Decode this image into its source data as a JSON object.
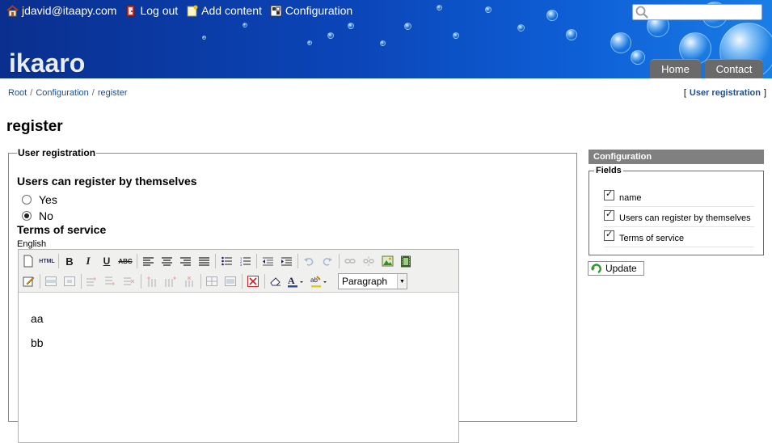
{
  "header": {
    "user": "jdavid@itaapy.com",
    "logout": "Log out",
    "add_content": "Add content",
    "configuration": "Configuration",
    "logo": "ikaaro",
    "search_placeholder": "",
    "nav": [
      "Home",
      "Contact"
    ]
  },
  "breadcrumb": {
    "items": [
      "Root",
      "Configuration",
      "register"
    ],
    "sep": "/",
    "toggle_open": "[",
    "toggle_label": "User registration",
    "toggle_close": "]"
  },
  "page": {
    "title": "register"
  },
  "form": {
    "legend": "User registration",
    "question": "Users can register by themselves",
    "options": [
      "Yes",
      "No"
    ],
    "selected": "No",
    "terms_label": "Terms of service",
    "language": "English",
    "format_select": "Paragraph",
    "content_lines": [
      "aa",
      "bb"
    ]
  },
  "sidebar": {
    "title": "Configuration",
    "fields_legend": "Fields",
    "fields": [
      "name",
      "Users can register by themselves",
      "Terms of service"
    ],
    "update_label": "Update"
  },
  "colors": {
    "header_blue": "#0b45b8",
    "link_blue": "#1c4f94",
    "tab_gray": "#6a6a6a",
    "panel_head_gray": "#808080"
  }
}
